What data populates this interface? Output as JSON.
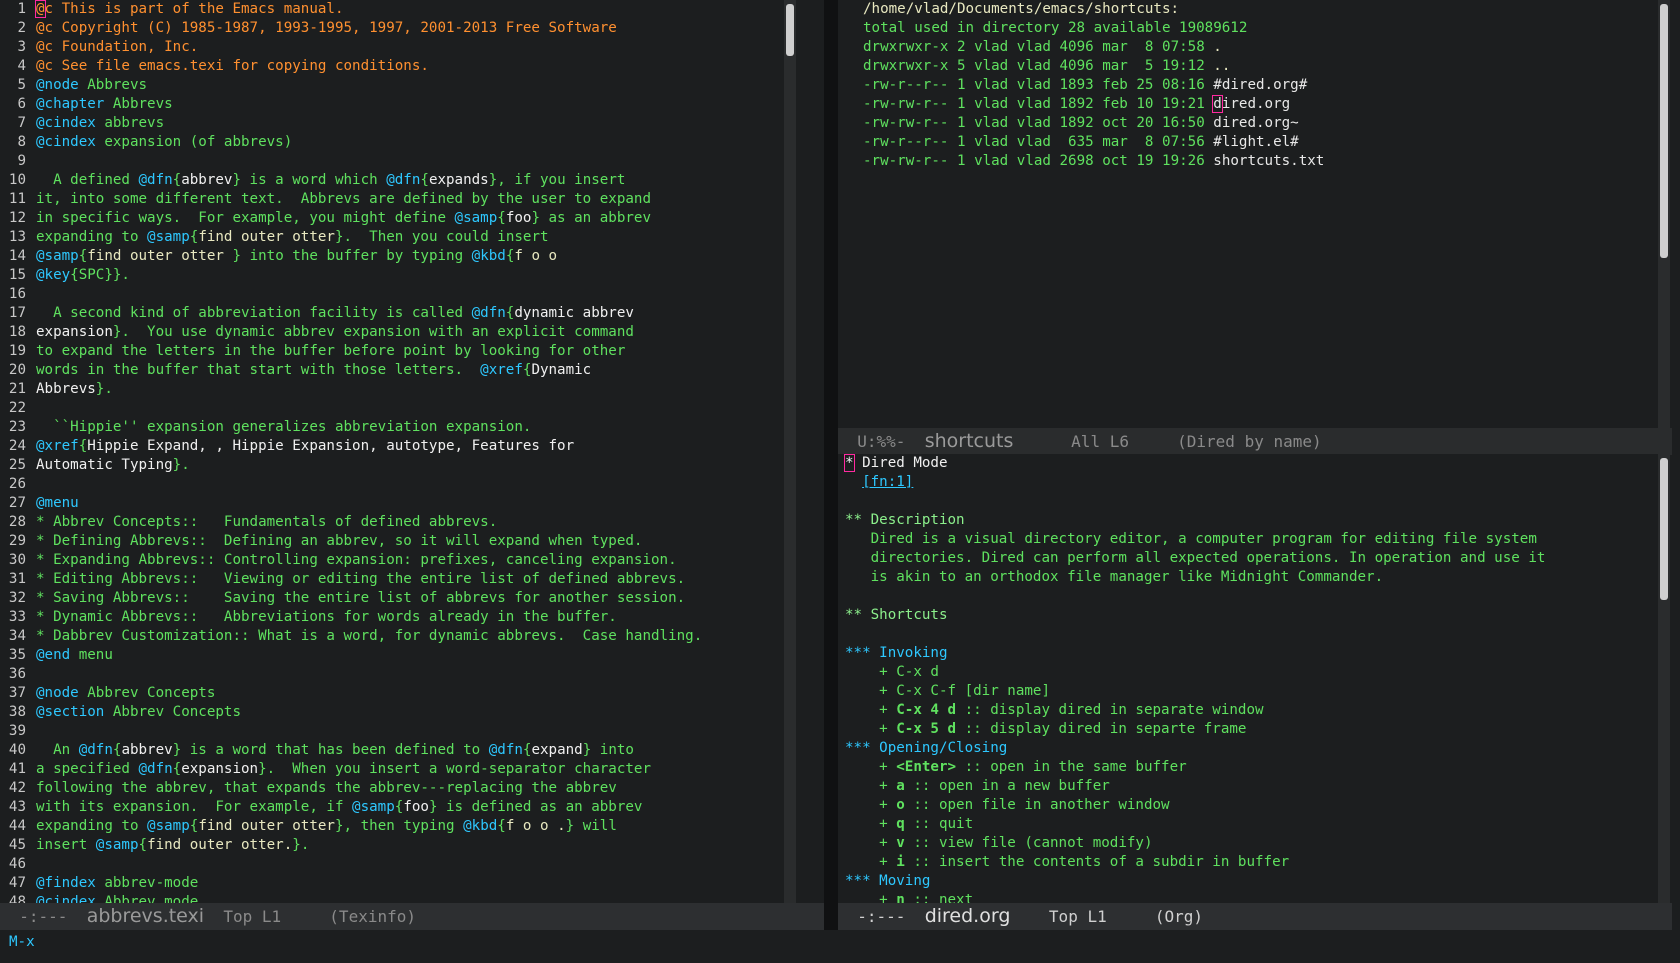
{
  "left_buffer": {
    "modeline": {
      "status": "-:---",
      "buffer": "abbrevs.texi",
      "position": "Top L1",
      "mode": "(Texinfo)"
    },
    "lines": [
      {
        "n": "1",
        "segs": [
          {
            "t": "@",
            "c": "c cur"
          },
          {
            "t": "c This is part of the Emacs manual.",
            "c": "c"
          }
        ]
      },
      {
        "n": "2",
        "segs": [
          {
            "t": "@c Copyright (C) 1985-1987, 1993-1995, 1997, 2001-2013 Free Software",
            "c": "c"
          }
        ]
      },
      {
        "n": "3",
        "segs": [
          {
            "t": "@c Foundation, Inc.",
            "c": "c"
          }
        ]
      },
      {
        "n": "4",
        "segs": [
          {
            "t": "@c See file emacs.texi for copying conditions.",
            "c": "c"
          }
        ]
      },
      {
        "n": "5",
        "segs": [
          {
            "t": "@node",
            "c": "k"
          },
          {
            "t": " Abbrevs",
            "c": "g"
          }
        ]
      },
      {
        "n": "6",
        "segs": [
          {
            "t": "@chapter",
            "c": "k"
          },
          {
            "t": " Abbrevs",
            "c": "g"
          }
        ]
      },
      {
        "n": "7",
        "segs": [
          {
            "t": "@cindex",
            "c": "k"
          },
          {
            "t": " abbrevs",
            "c": "g"
          }
        ]
      },
      {
        "n": "8",
        "segs": [
          {
            "t": "@cindex",
            "c": "k"
          },
          {
            "t": " expansion (of abbrevs)",
            "c": "g"
          }
        ]
      },
      {
        "n": "9",
        "segs": []
      },
      {
        "n": "10",
        "segs": [
          {
            "t": "  A defined ",
            "c": "g"
          },
          {
            "t": "@dfn",
            "c": "k"
          },
          {
            "t": "{",
            "c": "g"
          },
          {
            "t": "abbrev",
            "c": "w"
          },
          {
            "t": "} is a word which ",
            "c": "g"
          },
          {
            "t": "@dfn",
            "c": "k"
          },
          {
            "t": "{",
            "c": "g"
          },
          {
            "t": "expands",
            "c": "w"
          },
          {
            "t": "}, if you insert",
            "c": "g"
          }
        ]
      },
      {
        "n": "11",
        "segs": [
          {
            "t": "it, into some different text.  Abbrevs are defined by the user to expand",
            "c": "g"
          }
        ]
      },
      {
        "n": "12",
        "segs": [
          {
            "t": "in specific ways.  For example, you might define ",
            "c": "g"
          },
          {
            "t": "@samp",
            "c": "k"
          },
          {
            "t": "{",
            "c": "g"
          },
          {
            "t": "foo",
            "c": "w"
          },
          {
            "t": "} as an abbrev",
            "c": "g"
          }
        ]
      },
      {
        "n": "13",
        "segs": [
          {
            "t": "expanding to ",
            "c": "g"
          },
          {
            "t": "@samp",
            "c": "k"
          },
          {
            "t": "{",
            "c": "g"
          },
          {
            "t": "find outer otter",
            "c": "y"
          },
          {
            "t": "}.  Then you could insert",
            "c": "g"
          }
        ]
      },
      {
        "n": "14",
        "segs": [
          {
            "t": "@samp",
            "c": "k"
          },
          {
            "t": "{",
            "c": "g"
          },
          {
            "t": "find outer otter ",
            "c": "y"
          },
          {
            "t": "} into the buffer by typing ",
            "c": "g"
          },
          {
            "t": "@kbd",
            "c": "k"
          },
          {
            "t": "{",
            "c": "g"
          },
          {
            "t": "f o o",
            "c": "y"
          }
        ]
      },
      {
        "n": "15",
        "segs": [
          {
            "t": "@key",
            "c": "k"
          },
          {
            "t": "{SPC}}.",
            "c": "g"
          }
        ]
      },
      {
        "n": "16",
        "segs": []
      },
      {
        "n": "17",
        "segs": [
          {
            "t": "  A second kind of abbreviation facility is called ",
            "c": "g"
          },
          {
            "t": "@dfn",
            "c": "k"
          },
          {
            "t": "{",
            "c": "g"
          },
          {
            "t": "dynamic abbrev",
            "c": "w"
          }
        ]
      },
      {
        "n": "18",
        "segs": [
          {
            "t": "expansion",
            "c": "w"
          },
          {
            "t": "}.  You use dynamic abbrev expansion with an explicit command",
            "c": "g"
          }
        ]
      },
      {
        "n": "19",
        "segs": [
          {
            "t": "to expand the letters in the buffer before point by looking for other",
            "c": "g"
          }
        ]
      },
      {
        "n": "20",
        "segs": [
          {
            "t": "words in the buffer that start with those letters.  ",
            "c": "g"
          },
          {
            "t": "@xref",
            "c": "k"
          },
          {
            "t": "{",
            "c": "g"
          },
          {
            "t": "Dynamic",
            "c": "w"
          }
        ]
      },
      {
        "n": "21",
        "segs": [
          {
            "t": "Abbrevs",
            "c": "w"
          },
          {
            "t": "}.",
            "c": "g"
          }
        ]
      },
      {
        "n": "22",
        "segs": []
      },
      {
        "n": "23",
        "segs": [
          {
            "t": "  ``Hippie'' expansion generalizes abbreviation expansion.",
            "c": "g"
          }
        ]
      },
      {
        "n": "24",
        "segs": [
          {
            "t": "@xref",
            "c": "k"
          },
          {
            "t": "{",
            "c": "g"
          },
          {
            "t": "Hippie Expand, , Hippie Expansion, autotype, Features for",
            "c": "w"
          }
        ]
      },
      {
        "n": "25",
        "segs": [
          {
            "t": "Automatic Typing",
            "c": "w"
          },
          {
            "t": "}.",
            "c": "g"
          }
        ]
      },
      {
        "n": "26",
        "segs": []
      },
      {
        "n": "27",
        "segs": [
          {
            "t": "@menu",
            "c": "k"
          }
        ]
      },
      {
        "n": "28",
        "segs": [
          {
            "t": "* Abbrev Concepts::   Fundamentals of defined abbrevs.",
            "c": "g"
          }
        ]
      },
      {
        "n": "29",
        "segs": [
          {
            "t": "* Defining Abbrevs::  Defining an abbrev, so it will expand when typed.",
            "c": "g"
          }
        ]
      },
      {
        "n": "30",
        "segs": [
          {
            "t": "* Expanding Abbrevs:: Controlling expansion: prefixes, canceling expansion.",
            "c": "g"
          }
        ]
      },
      {
        "n": "31",
        "segs": [
          {
            "t": "* Editing Abbrevs::   Viewing or editing the entire list of defined abbrevs.",
            "c": "g"
          }
        ]
      },
      {
        "n": "32",
        "segs": [
          {
            "t": "* Saving Abbrevs::    Saving the entire list of abbrevs for another session.",
            "c": "g"
          }
        ]
      },
      {
        "n": "33",
        "segs": [
          {
            "t": "* Dynamic Abbrevs::   Abbreviations for words already in the buffer.",
            "c": "g"
          }
        ]
      },
      {
        "n": "34",
        "segs": [
          {
            "t": "* Dabbrev Customization:: What is a word, for dynamic abbrevs.  Case handling.",
            "c": "g"
          }
        ]
      },
      {
        "n": "35",
        "segs": [
          {
            "t": "@end",
            "c": "k"
          },
          {
            "t": " menu",
            "c": "g"
          }
        ]
      },
      {
        "n": "36",
        "segs": []
      },
      {
        "n": "37",
        "segs": [
          {
            "t": "@node",
            "c": "k"
          },
          {
            "t": " Abbrev Concepts",
            "c": "g"
          }
        ]
      },
      {
        "n": "38",
        "segs": [
          {
            "t": "@section",
            "c": "k"
          },
          {
            "t": " Abbrev Concepts",
            "c": "g"
          }
        ]
      },
      {
        "n": "39",
        "segs": []
      },
      {
        "n": "40",
        "segs": [
          {
            "t": "  An ",
            "c": "g"
          },
          {
            "t": "@dfn",
            "c": "k"
          },
          {
            "t": "{",
            "c": "g"
          },
          {
            "t": "abbrev",
            "c": "w"
          },
          {
            "t": "} is a word that has been defined to ",
            "c": "g"
          },
          {
            "t": "@dfn",
            "c": "k"
          },
          {
            "t": "{",
            "c": "g"
          },
          {
            "t": "expand",
            "c": "w"
          },
          {
            "t": "} into",
            "c": "g"
          }
        ]
      },
      {
        "n": "41",
        "segs": [
          {
            "t": "a specified ",
            "c": "g"
          },
          {
            "t": "@dfn",
            "c": "k"
          },
          {
            "t": "{",
            "c": "g"
          },
          {
            "t": "expansion",
            "c": "w"
          },
          {
            "t": "}.  When you insert a word-separator character",
            "c": "g"
          }
        ]
      },
      {
        "n": "42",
        "segs": [
          {
            "t": "following the abbrev, that expands the abbrev---replacing the abbrev",
            "c": "g"
          }
        ]
      },
      {
        "n": "43",
        "segs": [
          {
            "t": "with its expansion.  For example, if ",
            "c": "g"
          },
          {
            "t": "@samp",
            "c": "k"
          },
          {
            "t": "{",
            "c": "g"
          },
          {
            "t": "foo",
            "c": "w"
          },
          {
            "t": "} is defined as an abbrev",
            "c": "g"
          }
        ]
      },
      {
        "n": "44",
        "segs": [
          {
            "t": "expanding to ",
            "c": "g"
          },
          {
            "t": "@samp",
            "c": "k"
          },
          {
            "t": "{",
            "c": "g"
          },
          {
            "t": "find outer otter",
            "c": "y"
          },
          {
            "t": "}, then typing ",
            "c": "g"
          },
          {
            "t": "@kbd",
            "c": "k"
          },
          {
            "t": "{",
            "c": "g"
          },
          {
            "t": "f o o .",
            "c": "y"
          },
          {
            "t": "} will",
            "c": "g"
          }
        ]
      },
      {
        "n": "45",
        "segs": [
          {
            "t": "insert ",
            "c": "g"
          },
          {
            "t": "@samp",
            "c": "k"
          },
          {
            "t": "{",
            "c": "g"
          },
          {
            "t": "find outer otter.",
            "c": "y"
          },
          {
            "t": "}.",
            "c": "g"
          }
        ]
      },
      {
        "n": "46",
        "segs": []
      },
      {
        "n": "47",
        "segs": [
          {
            "t": "@findex",
            "c": "k"
          },
          {
            "t": " abbrev-mode",
            "c": "g"
          }
        ]
      },
      {
        "n": "48",
        "segs": [
          {
            "t": "@cindex",
            "c": "k"
          },
          {
            "t": " Abbrev mode",
            "c": "g"
          }
        ]
      }
    ]
  },
  "dired_buffer": {
    "header": "/home/vlad/Documents/emacs/shortcuts:",
    "total": "total used in directory 28 available 19089612",
    "entries": [
      {
        "perm": "drwxrwxr-x",
        "links": "2",
        "owner": "vlad",
        "group": "vlad",
        "size": "4096",
        "month": "mar",
        "day": " 8",
        "time": "07:58",
        "name": ".",
        "cursor": false
      },
      {
        "perm": "drwxrwxr-x",
        "links": "5",
        "owner": "vlad",
        "group": "vlad",
        "size": "4096",
        "month": "mar",
        "day": " 5",
        "time": "19:12",
        "name": "..",
        "cursor": false
      },
      {
        "perm": "-rw-r--r--",
        "links": "1",
        "owner": "vlad",
        "group": "vlad",
        "size": "1893",
        "month": "feb",
        "day": "25",
        "time": "08:16",
        "name": "#dired.org#",
        "cursor": false
      },
      {
        "perm": "-rw-rw-r--",
        "links": "1",
        "owner": "vlad",
        "group": "vlad",
        "size": "1892",
        "month": "feb",
        "day": "10",
        "time": "19:21",
        "name": "dired.org",
        "cursor": true
      },
      {
        "perm": "-rw-rw-r--",
        "links": "1",
        "owner": "vlad",
        "group": "vlad",
        "size": "1892",
        "month": "oct",
        "day": "20",
        "time": "16:50",
        "name": "dired.org~",
        "cursor": false
      },
      {
        "perm": "-rw-r--r--",
        "links": "1",
        "owner": "vlad",
        "group": "vlad",
        "size": " 635",
        "month": "mar",
        "day": " 8",
        "time": "07:56",
        "name": "#light.el#",
        "cursor": false
      },
      {
        "perm": "-rw-rw-r--",
        "links": "1",
        "owner": "vlad",
        "group": "vlad",
        "size": "2698",
        "month": "oct",
        "day": "19",
        "time": "19:26",
        "name": "shortcuts.txt",
        "cursor": false
      }
    ],
    "modeline": {
      "status": "U:%%-",
      "buffer": "shortcuts",
      "position": "All L6",
      "mode": "(Dired by name)"
    }
  },
  "org_buffer": {
    "lines": [
      {
        "segs": [
          {
            "t": "*",
            "c": "oh cur"
          },
          {
            "t": " Dired Mode",
            "c": "oh"
          }
        ]
      },
      {
        "segs": [
          {
            "t": "  ",
            "c": "g"
          },
          {
            "t": "[fn:1]",
            "c": "link"
          }
        ]
      },
      {
        "segs": []
      },
      {
        "segs": [
          {
            "t": "** Description",
            "c": "oh2"
          }
        ]
      },
      {
        "segs": [
          {
            "t": "   Dired is a visual directory editor, a computer program for editing file system",
            "c": "g"
          }
        ]
      },
      {
        "segs": [
          {
            "t": "   directories. Dired can perform all expected operations. In operation and use it",
            "c": "g"
          }
        ]
      },
      {
        "segs": [
          {
            "t": "   is akin to an orthodox file manager like Midnight Commander.",
            "c": "g"
          }
        ]
      },
      {
        "segs": []
      },
      {
        "segs": [
          {
            "t": "** Shortcuts",
            "c": "oh2"
          }
        ]
      },
      {
        "segs": []
      },
      {
        "segs": [
          {
            "t": "*** Invoking",
            "c": "oh3"
          }
        ]
      },
      {
        "segs": [
          {
            "t": "    + C-x d",
            "c": "g"
          }
        ]
      },
      {
        "segs": [
          {
            "t": "    + C-x C-f [dir name]",
            "c": "g"
          }
        ]
      },
      {
        "segs": [
          {
            "t": "    + ",
            "c": "g"
          },
          {
            "t": "C-x 4 d",
            "c": "ob"
          },
          {
            "t": " :: display dired in separate window",
            "c": "g"
          }
        ]
      },
      {
        "segs": [
          {
            "t": "    + ",
            "c": "g"
          },
          {
            "t": "C-x 5 d",
            "c": "ob"
          },
          {
            "t": " :: display dired in separte frame",
            "c": "g"
          }
        ]
      },
      {
        "segs": [
          {
            "t": "*** Opening/Closing",
            "c": "oh3"
          }
        ]
      },
      {
        "segs": [
          {
            "t": "    + ",
            "c": "g"
          },
          {
            "t": "<Enter>",
            "c": "ob"
          },
          {
            "t": " :: open in the same buffer",
            "c": "g"
          }
        ]
      },
      {
        "segs": [
          {
            "t": "    + ",
            "c": "g"
          },
          {
            "t": "a",
            "c": "ob"
          },
          {
            "t": " :: open in a new buffer",
            "c": "g"
          }
        ]
      },
      {
        "segs": [
          {
            "t": "    + ",
            "c": "g"
          },
          {
            "t": "o",
            "c": "ob"
          },
          {
            "t": " :: open file in another window",
            "c": "g"
          }
        ]
      },
      {
        "segs": [
          {
            "t": "    + ",
            "c": "g"
          },
          {
            "t": "q",
            "c": "ob"
          },
          {
            "t": " :: quit",
            "c": "g"
          }
        ]
      },
      {
        "segs": [
          {
            "t": "    + ",
            "c": "g"
          },
          {
            "t": "v",
            "c": "ob"
          },
          {
            "t": " :: view file (cannot modify)",
            "c": "g"
          }
        ]
      },
      {
        "segs": [
          {
            "t": "    + ",
            "c": "g"
          },
          {
            "t": "i",
            "c": "ob"
          },
          {
            "t": " :: insert the contents of a subdir in buffer",
            "c": "g"
          }
        ]
      },
      {
        "segs": [
          {
            "t": "*** Moving",
            "c": "oh3"
          }
        ]
      },
      {
        "segs": [
          {
            "t": "    + ",
            "c": "g"
          },
          {
            "t": "n",
            "c": "ob"
          },
          {
            "t": " :: next",
            "c": "g"
          }
        ]
      }
    ],
    "modeline": {
      "status": "-:---",
      "buffer": "dired.org",
      "position": "Top L1",
      "mode": "(Org)"
    }
  },
  "minibuffer": "M-x"
}
